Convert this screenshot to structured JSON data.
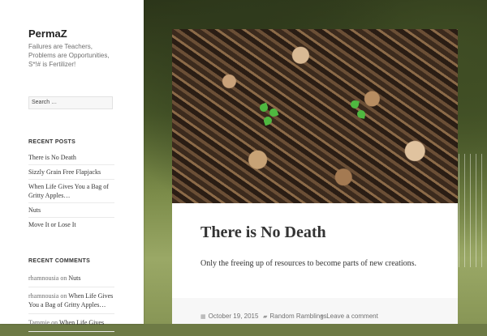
{
  "site": {
    "title": "PermaZ",
    "description": "Failures are Teachers, Problems are Opportunities, S*!# is Fertilizer!"
  },
  "search": {
    "placeholder": "Search …"
  },
  "recent_posts": {
    "heading": "RECENT POSTS",
    "items": [
      "There is No Death",
      "Sizzly Grain Free Flapjacks",
      "When Life Gives You a Bag of Gritty Apples…",
      "Nuts",
      "Move It or Lose It"
    ]
  },
  "recent_comments": {
    "heading": "RECENT COMMENTS",
    "items": [
      {
        "author": "rhamnousia",
        "on": "on",
        "post": "Nuts"
      },
      {
        "author": "rhamnousia",
        "on": "on",
        "post": "When Life Gives You a Bag of Gritty Apples…"
      },
      {
        "author": "Tammie",
        "on": "on",
        "post": "When Life Gives"
      }
    ]
  },
  "post": {
    "title": "There is No Death",
    "excerpt": "Only the freeing up of resources to become parts of new creations.",
    "date": "October 19, 2015",
    "category": "Random Ramblings",
    "comment_link": "Leave a comment"
  },
  "icons": {
    "date": "calendar-icon",
    "category": "folder-icon",
    "comment": "speech-bubble-icon"
  }
}
